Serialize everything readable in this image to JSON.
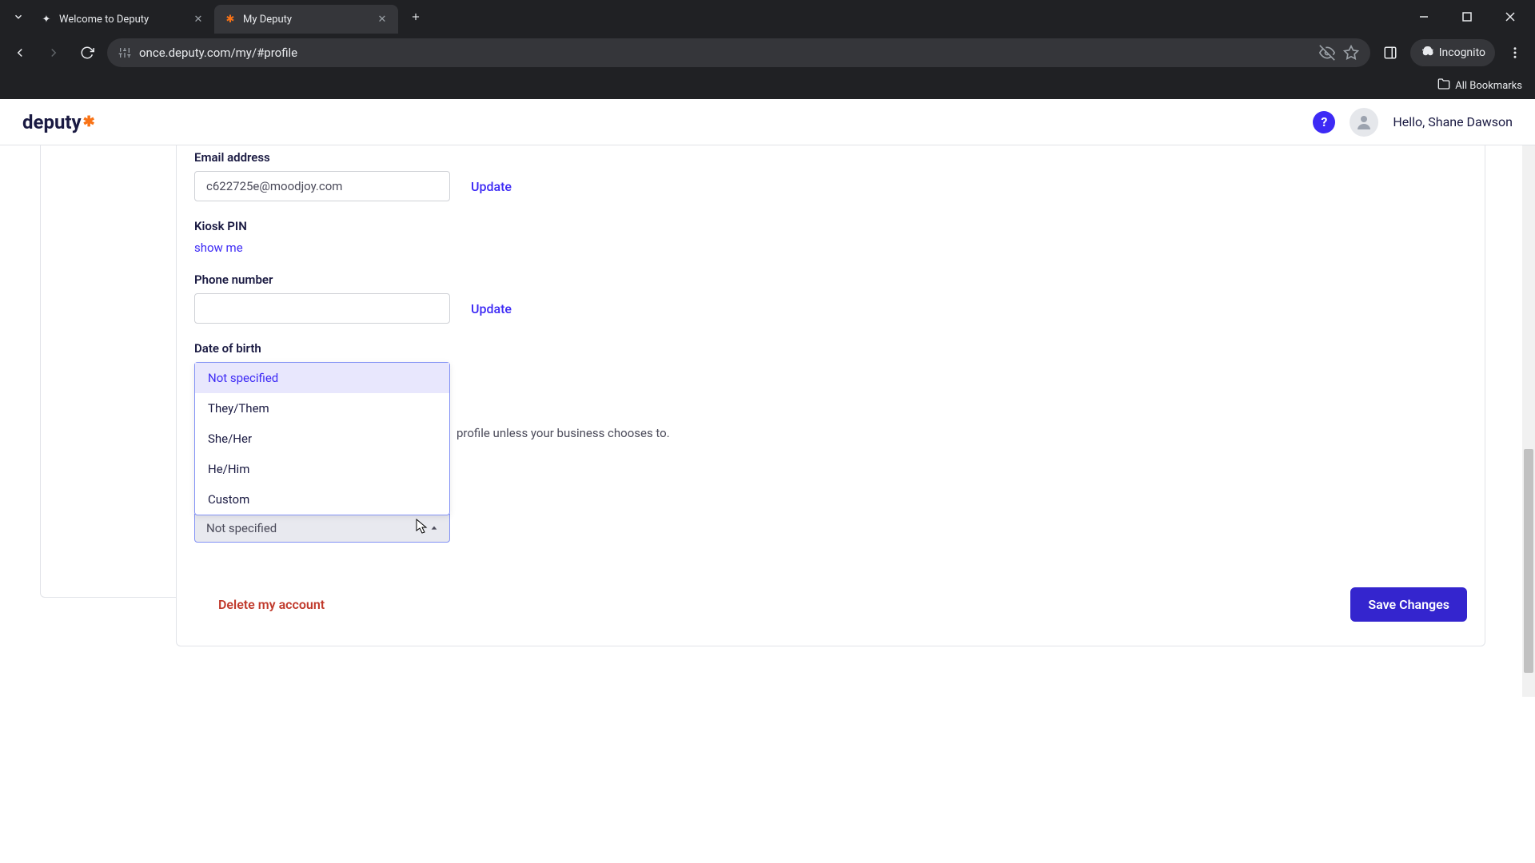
{
  "browser": {
    "tabs": [
      {
        "title": "Welcome to Deputy"
      },
      {
        "title": "My Deputy"
      }
    ],
    "url": "once.deputy.com/my/#profile",
    "incognito_label": "Incognito",
    "all_bookmarks": "All Bookmarks"
  },
  "header": {
    "logo_text": "deputy",
    "greeting": "Hello, Shane Dawson"
  },
  "form": {
    "email_label": "Email address",
    "email_value": "c622725e@moodjoy.com",
    "update_label": "Update",
    "kiosk_label": "Kiosk PIN",
    "show_me": "show me",
    "phone_label": "Phone number",
    "phone_value": "",
    "dob_label": "Date of birth",
    "pronoun_options": [
      "Not specified",
      "They/Them",
      "She/Her",
      "He/Him",
      "Custom"
    ],
    "pronoun_selected": "Not specified",
    "helper_partial": "profile unless your business chooses to.",
    "delete_label": "Delete my account",
    "save_label": "Save Changes"
  }
}
